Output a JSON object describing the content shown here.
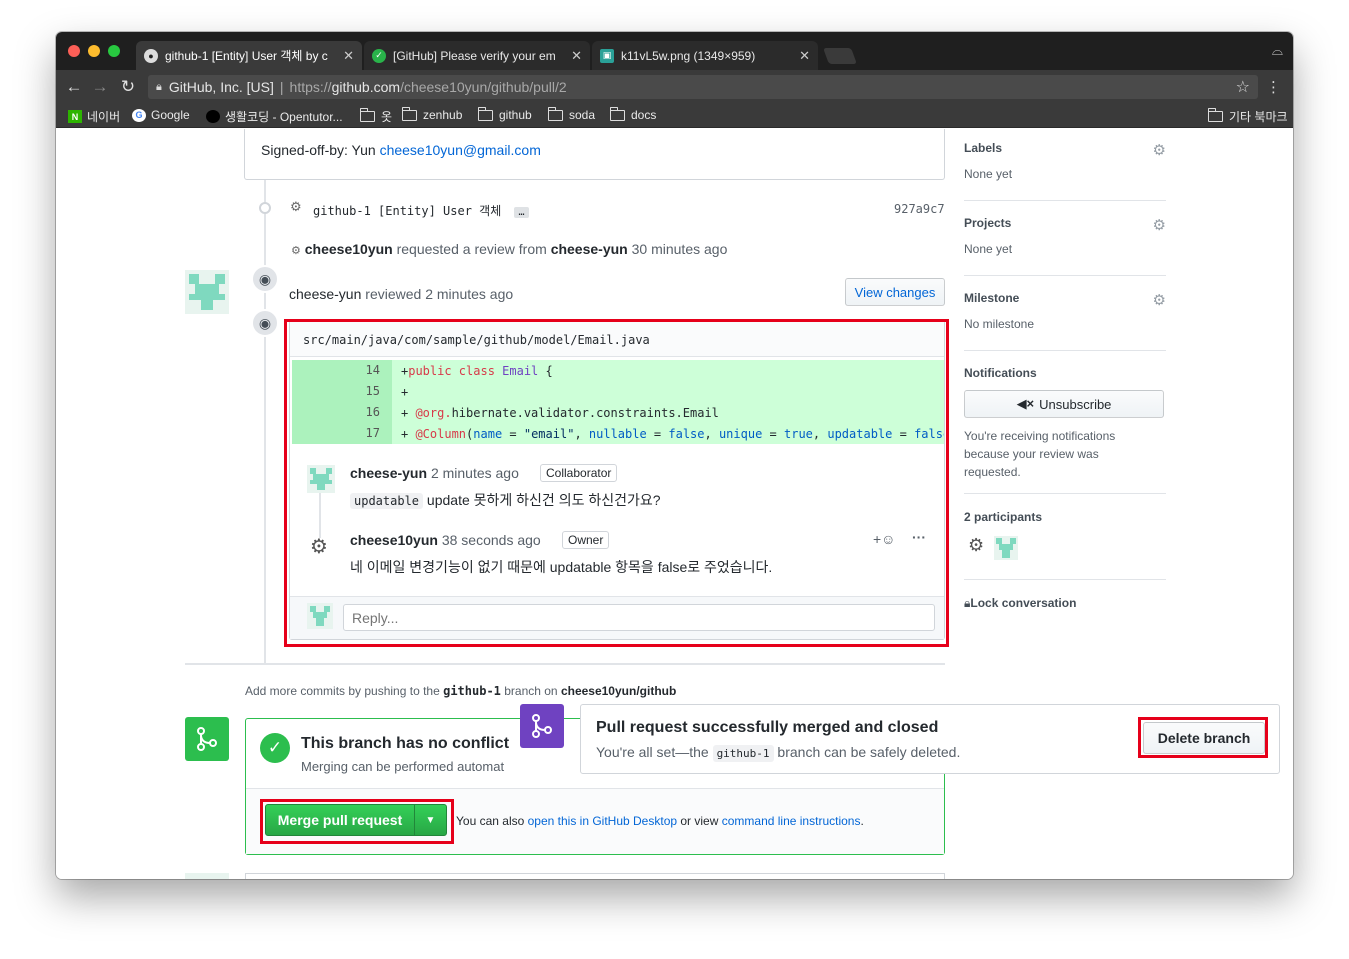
{
  "browser": {
    "tabs": [
      {
        "label": "github-1 [Entity] User 객체 by c",
        "icon": "github-icon"
      },
      {
        "label": "[GitHub] Please verify your em",
        "icon": "inbox-icon"
      },
      {
        "label": "k11vL5w.png (1349×959)",
        "icon": "image-icon"
      }
    ],
    "close_glyph": "✕",
    "url_org": "GitHub, Inc. [US]",
    "url_scheme": "https://",
    "url_host": "github.com",
    "url_path": "/cheese10yun/github/pull/2",
    "bookmarks": [
      {
        "label": "네이버",
        "type": "naver"
      },
      {
        "label": "Google",
        "type": "google"
      },
      {
        "label": "생활코딩 - Opentutor...",
        "type": "circle"
      },
      {
        "label": "옷",
        "type": "folder"
      },
      {
        "label": "zenhub",
        "type": "folder"
      },
      {
        "label": "github",
        "type": "folder"
      },
      {
        "label": "soda",
        "type": "folder"
      },
      {
        "label": "docs",
        "type": "folder"
      },
      {
        "label": "기타 북마크",
        "type": "folder"
      }
    ]
  },
  "timeline": {
    "signed_off_prefix": "Signed-off-by: Yun ",
    "signed_off_email": "cheese10yun@gmail.com",
    "commit_msg": "github-1 [Entity] User 객체",
    "commit_ellipsis": "…",
    "commit_sha": "927a9c7",
    "review_request_user": "cheese10yun",
    "review_request_text": " requested a review from ",
    "review_request_target": "cheese-yun",
    "review_request_time": " 30 minutes ago",
    "reviewed_user": "cheese-yun",
    "reviewed_text": " reviewed ",
    "reviewed_time": "2 minutes ago",
    "view_changes": "View changes"
  },
  "review": {
    "file_path": "src/main/java/com/sample/github/model/Email.java",
    "diff_lines": [
      {
        "num": "14"
      },
      {
        "num": "15"
      },
      {
        "num": "16"
      },
      {
        "num": "17"
      }
    ],
    "comments": [
      {
        "author": "cheese-yun",
        "time": "2 minutes ago",
        "role": "Collaborator",
        "code": "updatable",
        "body": " update 못하게 하신건 의도 하신건가요?"
      },
      {
        "author": "cheese10yun",
        "time": "38 seconds ago",
        "role": "Owner",
        "body": "네 이메일 변경기능이 없기 때문에 updatable 항목을 false로 주었습니다."
      }
    ],
    "reply_placeholder": "Reply..."
  },
  "merge": {
    "add_commits_prefix": "Add more commits by pushing to the ",
    "branch": "github-1",
    "add_commits_mid": " branch on ",
    "repo": "cheese10yun/github",
    "no_conflict_title": "This branch has no conflict",
    "no_conflict_sub": "Merging can be performed automat",
    "merge_button": "Merge pull request",
    "also_prefix": "You can also ",
    "desktop_link": "open this in GitHub Desktop",
    "also_mid": " or view ",
    "cli_link": "command line instructions",
    "also_suffix": ".",
    "merged_title": "Pull request successfully merged and closed",
    "merged_sub_prefix": "You're all set—the ",
    "merged_sub_suffix": " branch can be safely deleted.",
    "delete_branch": "Delete branch"
  },
  "sidebar": {
    "labels_title": "Labels",
    "labels_value": "None yet",
    "projects_title": "Projects",
    "projects_value": "None yet",
    "milestone_title": "Milestone",
    "milestone_value": "No milestone",
    "notifications_title": "Notifications",
    "unsubscribe": "Unsubscribe",
    "notifications_reason": "You're receiving notifications because your review was requested.",
    "participants_title": "2 participants",
    "lock": "Lock conversation"
  },
  "colors": {
    "accent_green": "#2cbe4e",
    "merged_purple": "#6f42c1",
    "link_blue": "#0366d6",
    "highlight_red": "#e6001a"
  }
}
